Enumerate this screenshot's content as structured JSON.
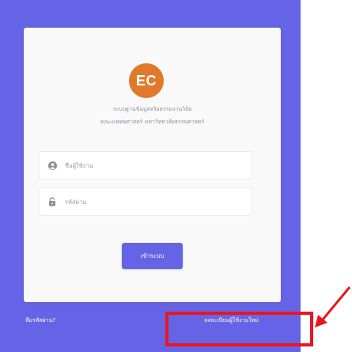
{
  "logo": {
    "text": "EC",
    "color": "#e07a2b"
  },
  "header": {
    "line1": "ระบบฐานข้อมูลจริยธรรมงานวิจัย",
    "line2": "คณะแพทยศาสตร์ มหาวิทยาลัยธรรมศาสตร์"
  },
  "form": {
    "username_placeholder": "ชื่อผู้ใช้งาน",
    "username_value": "",
    "password_placeholder": "รหัสผ่าน",
    "password_value": "",
    "login_label": "เข้าระบบ"
  },
  "footer": {
    "forgot_label": "ลืมรหัสผ่าน?",
    "register_label": "ลงทะเบียนผู้ใช้งานใหม่"
  },
  "colors": {
    "background": "#6664e6",
    "card": "#f9f9fa",
    "accent": "#6664e6",
    "annotation": "#e8161e"
  },
  "icons": {
    "username": "user-circle-icon",
    "password": "lock-icon",
    "annotation": "arrow-icon"
  }
}
